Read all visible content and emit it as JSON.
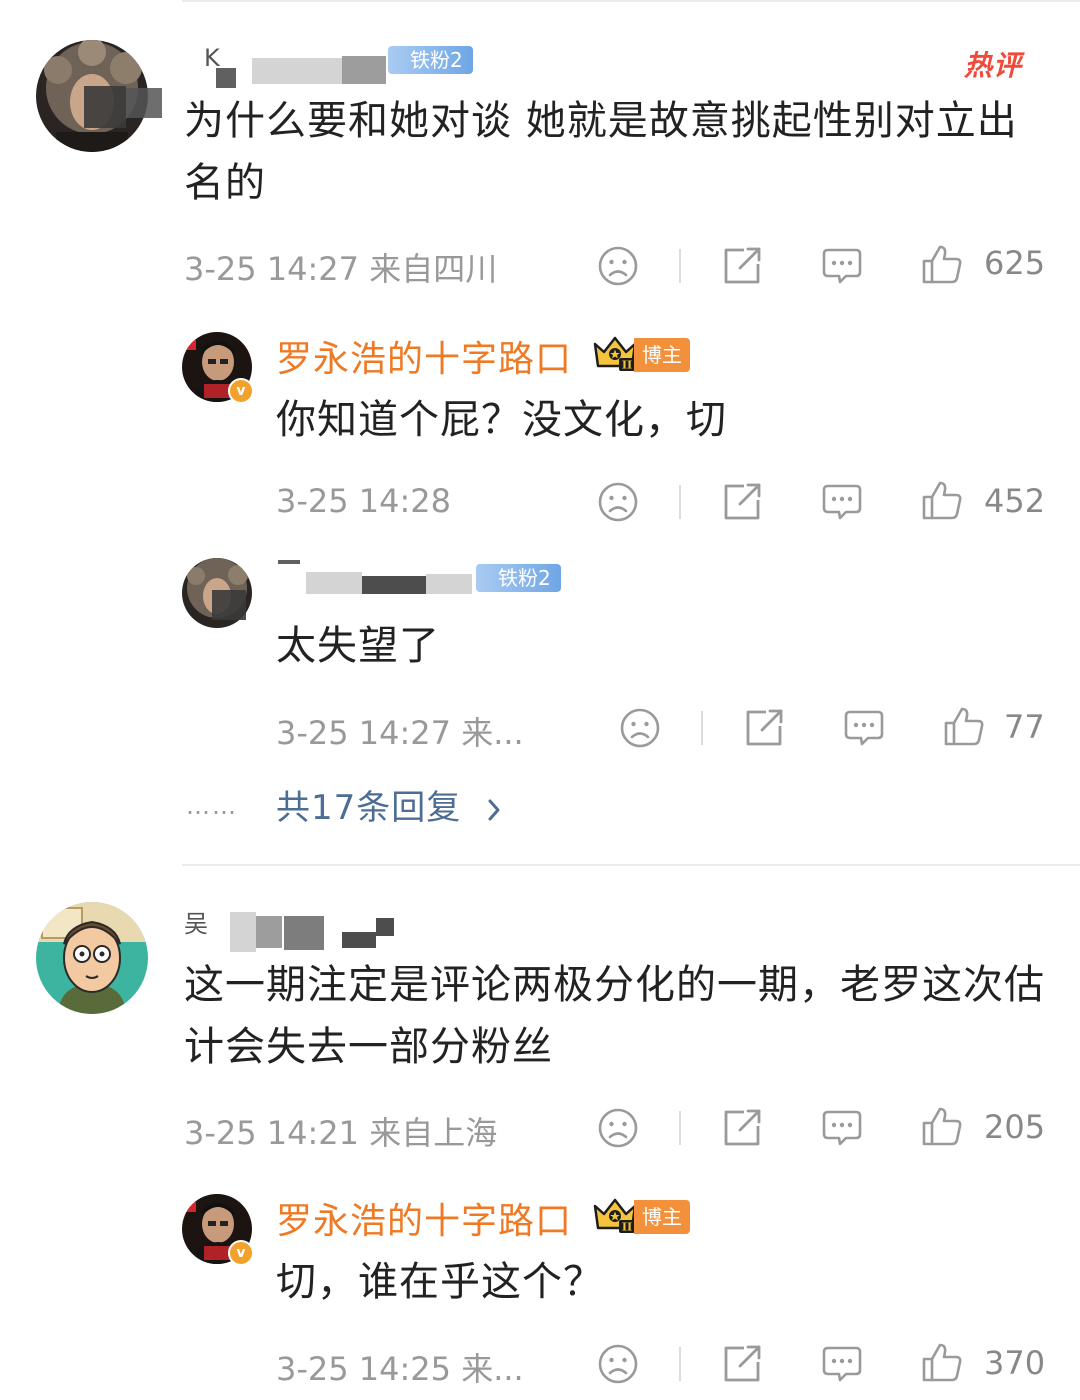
{
  "comments": [
    {
      "user": {
        "name": "K",
        "fan_badge": "铁粉2",
        "hot_tag": "热评"
      },
      "text": "为什么要和她对谈 她就是故意挑起性别对立出名的",
      "meta": "3-25 14:27  来自四川",
      "likes": "625",
      "replies": [
        {
          "user": {
            "name": "罗永浩的十字路口",
            "crown_level": "II",
            "role_badge": "博主"
          },
          "text": "你知道个屁？没文化，切",
          "meta": "3-25 14:28",
          "likes": "452"
        },
        {
          "user": {
            "name": "",
            "fan_badge": "铁粉2"
          },
          "text": "太失望了",
          "meta": "3-25 14:27  来...",
          "likes": "77"
        }
      ],
      "more_dots": "……",
      "more_replies": "共17条回复"
    },
    {
      "user": {
        "name": "吴"
      },
      "text": "这一期注定是评论两极分化的一期，老罗这次估计会失去一部分粉丝",
      "meta": "3-25 14:21  来自上海",
      "likes": "205",
      "replies": [
        {
          "user": {
            "name": "罗永浩的十字路口",
            "crown_level": "II",
            "role_badge": "博主"
          },
          "text": "切，谁在乎这个？",
          "meta": "3-25 14:25  来...",
          "likes": "370"
        }
      ]
    }
  ],
  "icons": {
    "dislike": "frown-face-icon",
    "share": "share-icon",
    "comment": "comment-bubble-icon",
    "like": "thumbs-up-icon",
    "chevron": "chevron-right-icon"
  },
  "colors": {
    "blogger_name": "#ee7a26",
    "fan_badge": "#6fa6e6",
    "hot_tag": "#f04a3b",
    "more_replies": "#4e6d94",
    "meta": "#999999"
  }
}
